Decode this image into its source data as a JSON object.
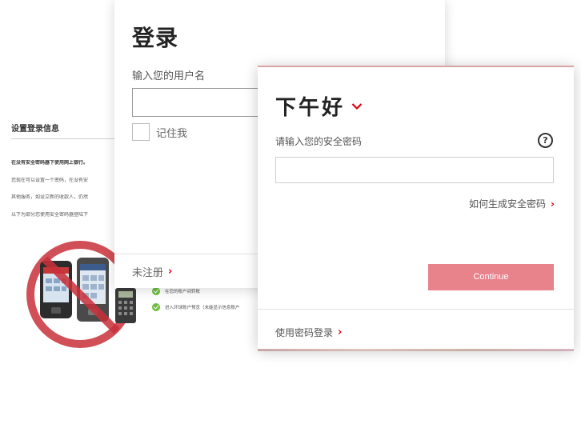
{
  "background": {
    "section_title": "设置登录信息",
    "lines": [
      {
        "text": "在没有安全密码器下使用网上银行。",
        "bold": true
      },
      {
        "text": "您现在可以设置一个密码，在没有安",
        "bold": false
      },
      {
        "text": "其他服务，如设立新的收款人，仍然",
        "bold": false
      },
      {
        "text": "以下为部分您使用安全密码器登陆下",
        "bold": false
      }
    ],
    "checklist": [
      "在您的账户间转账",
      "进入环球账户预览（未能显示信息账户"
    ]
  },
  "login_card": {
    "title": "登录",
    "username_label": "输入您的用户名",
    "username_value": "",
    "remember_label": "记住我",
    "register_link": "未注册"
  },
  "password_card": {
    "greeting": "下午好",
    "password_label": "请输入您的安全密码",
    "help_symbol": "?",
    "password_value": "",
    "how_link": "如何生成安全密码",
    "continue_label": "Continue",
    "password_login_link": "使用密码登录"
  },
  "colors": {
    "accent": "#db0011",
    "continue_bg": "#e8828b",
    "check_green": "#6dbd3f"
  }
}
